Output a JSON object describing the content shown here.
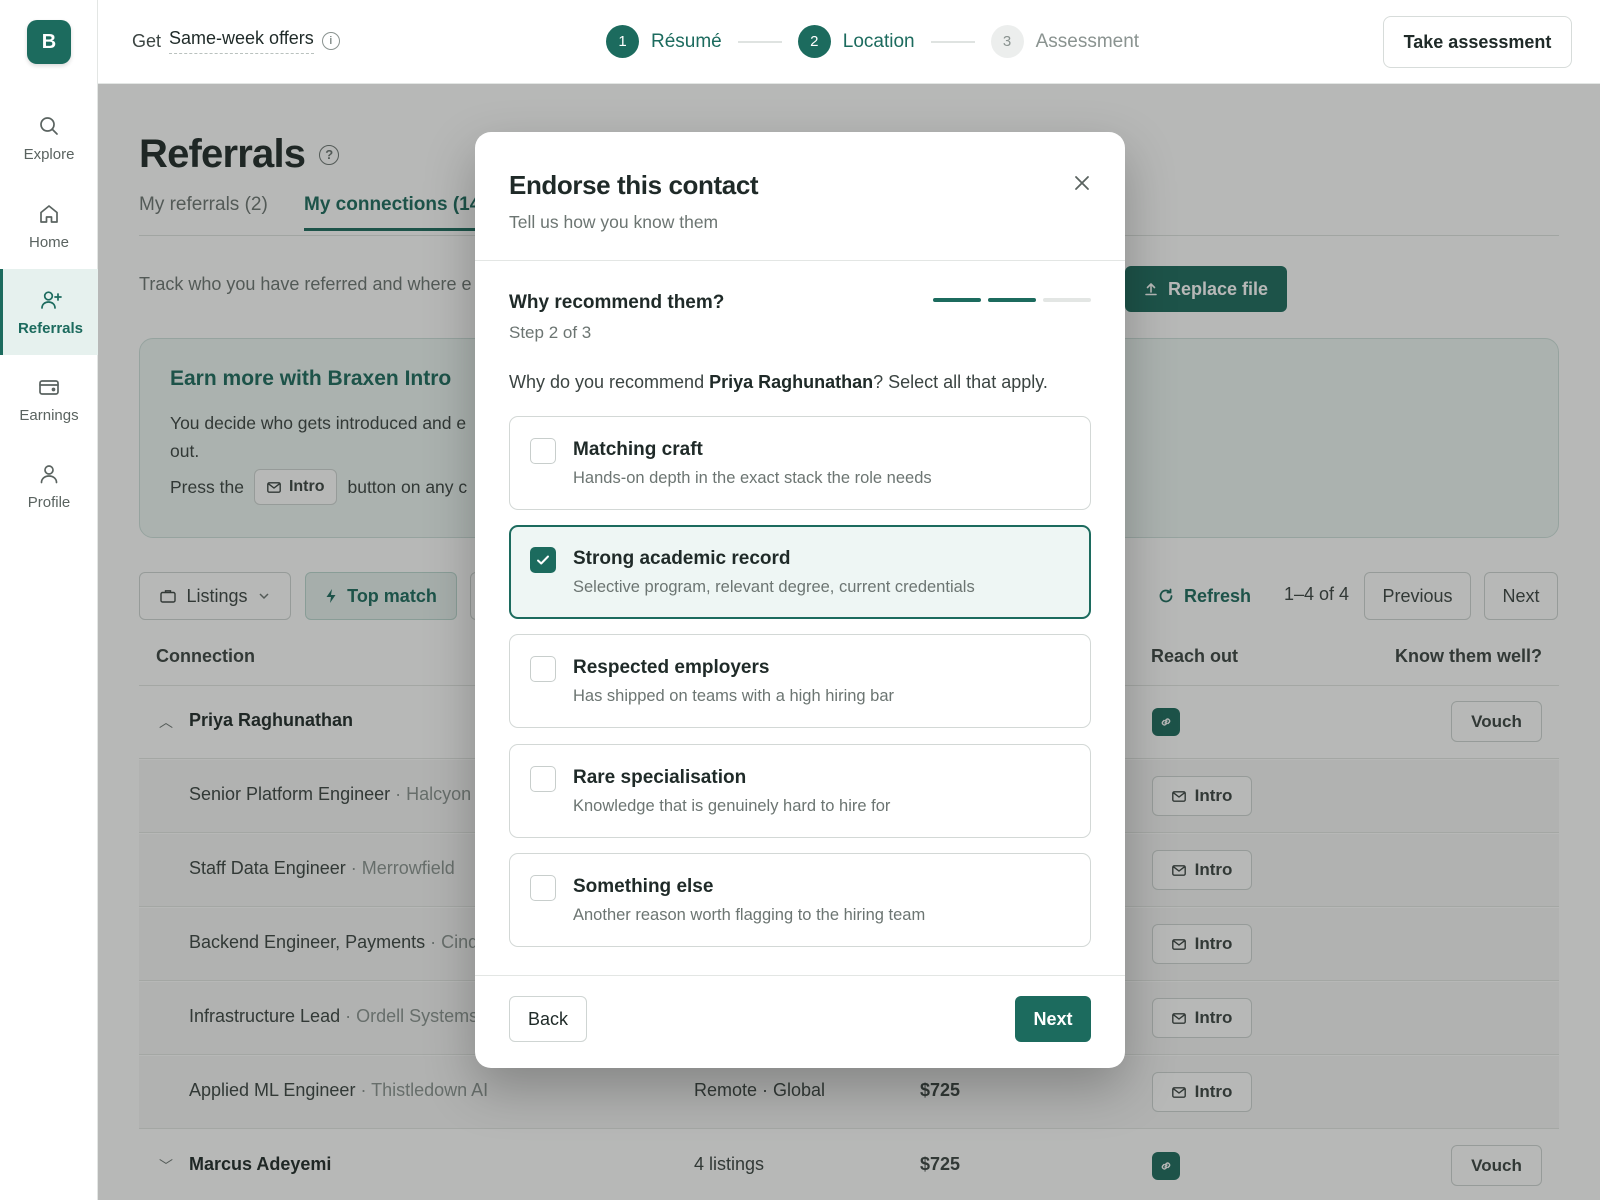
{
  "brand": {
    "logo_letter": "B",
    "accent": "#1c6b5e"
  },
  "sidebar": {
    "items": [
      {
        "label": "Explore",
        "icon": "search-icon"
      },
      {
        "label": "Home",
        "icon": "home-icon"
      },
      {
        "label": "Referrals",
        "icon": "add-user-icon",
        "active": true
      },
      {
        "label": "Earnings",
        "icon": "wallet-icon"
      },
      {
        "label": "Profile",
        "icon": "user-icon"
      }
    ]
  },
  "topbar": {
    "get_label": "Get",
    "offer_value": "Same-week offers",
    "steps": [
      {
        "num": "1",
        "label": "Résumé",
        "state": "done"
      },
      {
        "num": "2",
        "label": "Location",
        "state": "done"
      },
      {
        "num": "3",
        "label": "Assessment",
        "state": "todo"
      }
    ],
    "take_assessment": "Take assessment"
  },
  "page": {
    "title": "Referrals",
    "tabs": [
      "My referrals (2)",
      "My connections (14"
    ],
    "subtitle": "Track who you have referred and where e",
    "replace_file": "Replace file",
    "promo": {
      "title": "Earn more with Braxen Intro",
      "line1": "You decide who gets introduced and e",
      "line1b": "out.",
      "press_the": "Press the",
      "intro_chip": "Intro",
      "button_on_any": "button on any c"
    },
    "toolbar": {
      "listings": "Listings",
      "top_match": "Top match",
      "refresh": "Refresh",
      "range": "1–4 of 4",
      "previous": "Previous",
      "next": "Next"
    },
    "columns": {
      "connection": "Connection",
      "reach_out": "Reach out",
      "know_them": "Know them well?"
    },
    "rows": [
      {
        "type": "parent",
        "name": "Priya Raghunathan",
        "expanded": true,
        "action": "Vouch"
      },
      {
        "type": "child",
        "role": "Senior Platform Engineer",
        "company": "Halcyon",
        "intro": "Intro"
      },
      {
        "type": "child",
        "role": "Staff Data Engineer",
        "company": "Merrowfield",
        "intro": "Intro"
      },
      {
        "type": "child",
        "role": "Backend Engineer, Payments",
        "company": "Cind",
        "intro": "Intro"
      },
      {
        "type": "child",
        "role": "Infrastructure Lead",
        "company": "Ordell Systems",
        "intro": "Intro"
      },
      {
        "type": "child",
        "role": "Applied ML Engineer",
        "company": "Thistledown AI",
        "location": "Remote · Global",
        "amount": "$725",
        "intro": "Intro"
      },
      {
        "type": "parent",
        "name": "Marcus Adeyemi",
        "expanded": false,
        "listings": "4 listings",
        "amount": "$725",
        "action": "Vouch"
      }
    ],
    "separator": " · "
  },
  "modal": {
    "title": "Endorse this contact",
    "subtitle": "Tell us how you know them",
    "question": "Why recommend them?",
    "step_text": "Step 2 of 3",
    "progress": {
      "current": 2,
      "total": 3
    },
    "prompt_before": "Why do you recommend ",
    "prompt_name": "Priya Raghunathan",
    "prompt_after": "? Select all that apply.",
    "options": [
      {
        "title": "Matching craft",
        "desc": "Hands-on depth in the exact stack the role needs",
        "checked": false
      },
      {
        "title": "Strong academic record",
        "desc": "Selective program, relevant degree, current credentials",
        "checked": true
      },
      {
        "title": "Respected employers",
        "desc": "Has shipped on teams with a high hiring bar",
        "checked": false
      },
      {
        "title": "Rare specialisation",
        "desc": "Knowledge that is genuinely hard to hire for",
        "checked": false
      },
      {
        "title": "Something else",
        "desc": "Another reason worth flagging to the hiring team",
        "checked": false
      }
    ],
    "back": "Back",
    "next": "Next"
  }
}
